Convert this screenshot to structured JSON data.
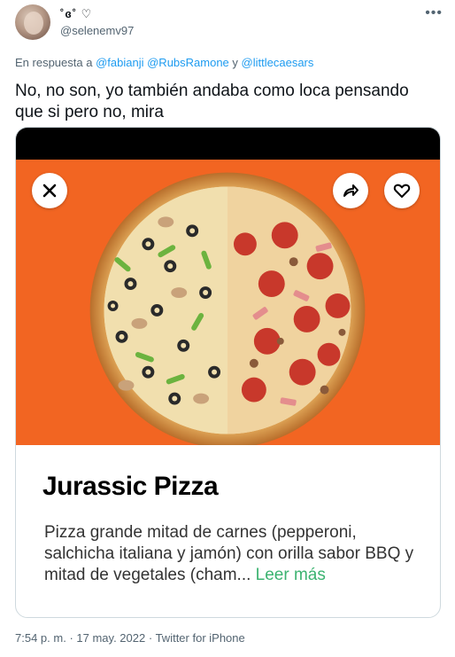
{
  "tweet": {
    "display_name": "˚ɞ˚ ♡",
    "handle": "@selenemv97",
    "reply_prefix": "En respuesta a",
    "reply_users": [
      "@fabianji",
      "@RubsRamone",
      "@littlecaesars"
    ],
    "reply_joiner": "y",
    "text": "No, no son, yo también andaba como loca pensando que si pero no, mira",
    "time": "7:54 p. m.",
    "date": "17 may. 2022",
    "source": "Twitter for iPhone",
    "separator": "·"
  },
  "media_card": {
    "title": "Jurassic Pizza",
    "description": "Pizza grande mitad de carnes (pepperoni, salchicha italiana y jamón) con orilla sabor BBQ y mitad de vegetales (cham...",
    "read_more": "Leer más",
    "background_color": "#f26522",
    "link_color": "#3cb371"
  },
  "icons": {
    "more": "more-icon",
    "close": "close-icon",
    "share": "share-icon",
    "favorite": "heart-icon"
  }
}
